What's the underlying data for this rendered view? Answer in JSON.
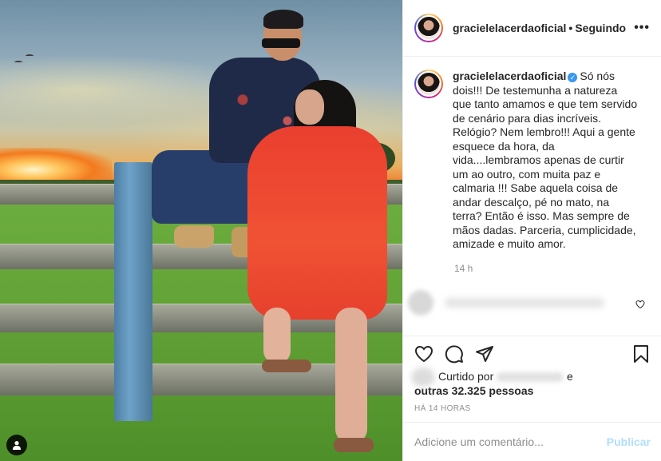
{
  "post": {
    "username": "gracielelacerdaoficial",
    "follow_status": "Seguindo",
    "more_label": "•••",
    "caption_text": "Só nós dois!!! De testemunha a natureza que tanto amamos e que tem servido de cenário para dias incríveis. Relógio? Nem lembro!!! Aqui a gente esquece da hora, da vida....lembramos apenas de curtir um ao outro, com muita paz e calmaria !!! Sabe aquela coisa de andar descalço, pé no mato, na terra? Então é isso. Mas sempre de mãos dadas. Parceria, cumplicidade, amizade e muito amor.",
    "caption_time": "14 h",
    "likes_prefix": "Curtido por",
    "likes_connector": "e",
    "likes_others": "outras 32.325 pessoas",
    "post_time": "HÁ 14 HORAS",
    "comment_placeholder": "Adicione um comentário...",
    "publish_label": "Publicar"
  },
  "icons": {
    "like": "heart-icon",
    "comment": "comment-icon",
    "share": "share-icon",
    "save": "bookmark-icon",
    "tag": "user-icon",
    "verified": "verified-icon"
  },
  "colors": {
    "primary_text": "#262626",
    "secondary_text": "#8e8e8e",
    "verified_blue": "#3897f0",
    "publish_disabled": "#b2dffc",
    "border": "#efefef"
  }
}
